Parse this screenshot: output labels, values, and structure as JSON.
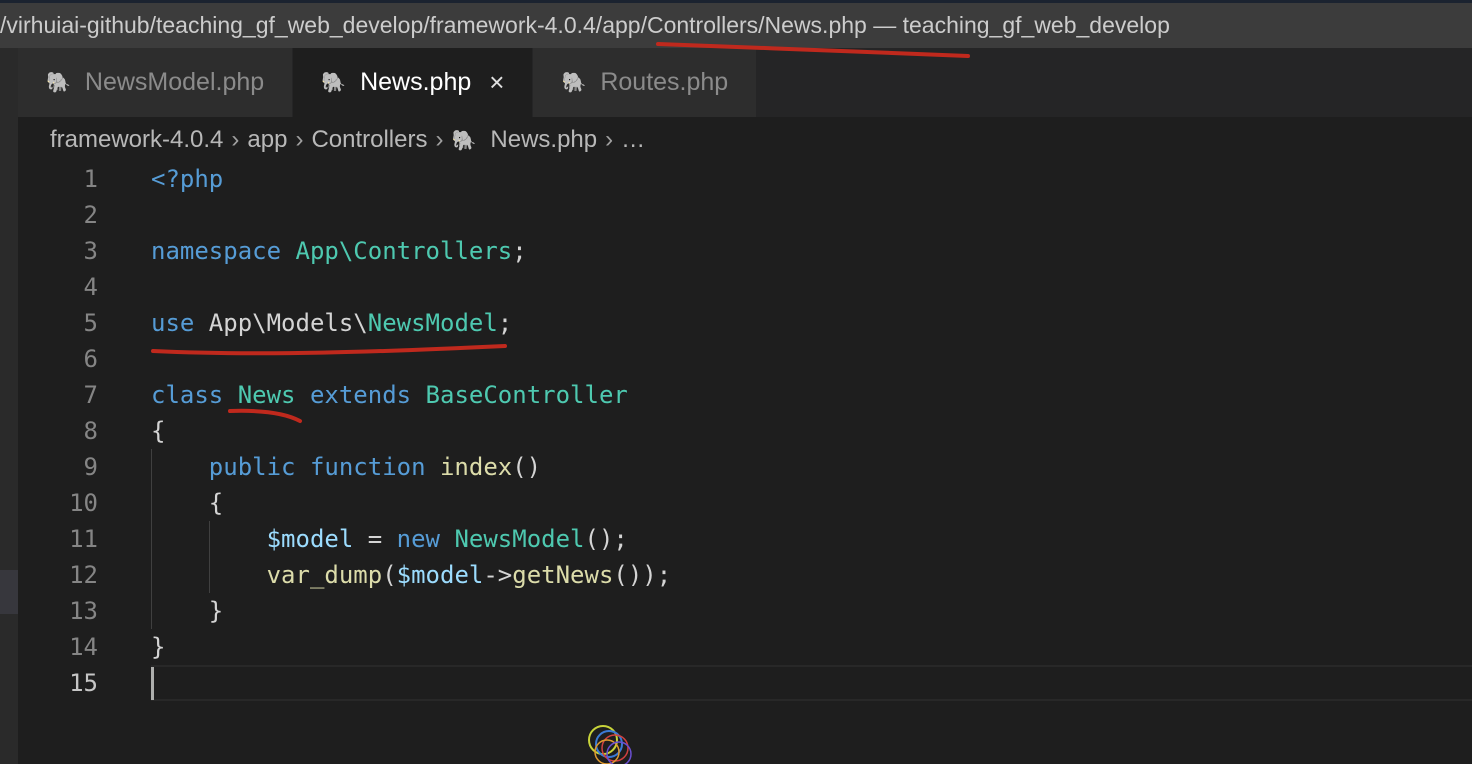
{
  "window_title": "/virhuiai-github/teaching_gf_web_develop/framework-4.0.4/app/Controllers/News.php — teaching_gf_web_develop",
  "tabs": [
    {
      "label": "NewsModel.php",
      "active": false
    },
    {
      "label": "News.php",
      "active": true,
      "close": "×"
    },
    {
      "label": "Routes.php",
      "active": false
    }
  ],
  "breadcrumb": [
    "framework-4.0.4",
    "app",
    "Controllers",
    "News.php",
    "…"
  ],
  "colors": {
    "keyword": "#569cd6",
    "type": "#4ec9b0",
    "func": "#dcdcaa",
    "var": "#9cdcfe",
    "text": "#d4d4d4",
    "annotation": "#c0291d"
  },
  "code_lines": [
    [
      {
        "t": "<?php",
        "c": "keyword"
      }
    ],
    [],
    [
      {
        "t": "namespace ",
        "c": "keyword"
      },
      {
        "t": "App\\Controllers",
        "c": "type"
      },
      {
        "t": ";",
        "c": "text"
      }
    ],
    [],
    [
      {
        "t": "use ",
        "c": "keyword"
      },
      {
        "t": "App\\Models\\",
        "c": "text"
      },
      {
        "t": "NewsModel",
        "c": "type"
      },
      {
        "t": ";",
        "c": "text"
      }
    ],
    [],
    [
      {
        "t": "class ",
        "c": "keyword"
      },
      {
        "t": "News",
        "c": "type"
      },
      {
        "t": " extends ",
        "c": "keyword"
      },
      {
        "t": "BaseController",
        "c": "type"
      }
    ],
    [
      {
        "t": "{",
        "c": "text"
      }
    ],
    [
      {
        "t": "    public function ",
        "c": "keyword"
      },
      {
        "t": "index",
        "c": "func"
      },
      {
        "t": "()",
        "c": "text"
      }
    ],
    [
      {
        "t": "    {",
        "c": "text"
      }
    ],
    [
      {
        "t": "        ",
        "c": "text"
      },
      {
        "t": "$model",
        "c": "var"
      },
      {
        "t": " = ",
        "c": "text"
      },
      {
        "t": "new ",
        "c": "keyword"
      },
      {
        "t": "NewsModel",
        "c": "type"
      },
      {
        "t": "();",
        "c": "text"
      }
    ],
    [
      {
        "t": "        ",
        "c": "text"
      },
      {
        "t": "var_dump",
        "c": "func"
      },
      {
        "t": "(",
        "c": "text"
      },
      {
        "t": "$model",
        "c": "var"
      },
      {
        "t": "->",
        "c": "text"
      },
      {
        "t": "getNews",
        "c": "func"
      },
      {
        "t": "());",
        "c": "text"
      }
    ],
    [
      {
        "t": "    }",
        "c": "text"
      }
    ],
    [
      {
        "t": "}",
        "c": "text"
      }
    ],
    []
  ],
  "current_line": 15
}
